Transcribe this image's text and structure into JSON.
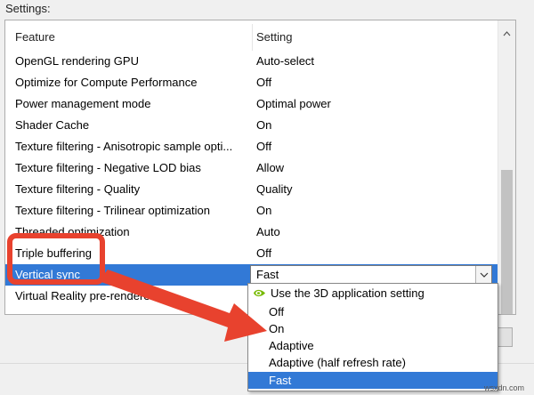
{
  "heading": "Settings:",
  "columns": {
    "feature": "Feature",
    "setting": "Setting"
  },
  "rows": [
    {
      "feature": "OpenGL rendering GPU",
      "setting": "Auto-select"
    },
    {
      "feature": "Optimize for Compute Performance",
      "setting": "Off"
    },
    {
      "feature": "Power management mode",
      "setting": "Optimal power"
    },
    {
      "feature": "Shader Cache",
      "setting": "On"
    },
    {
      "feature": "Texture filtering - Anisotropic sample opti...",
      "setting": "Off"
    },
    {
      "feature": "Texture filtering - Negative LOD bias",
      "setting": "Allow"
    },
    {
      "feature": "Texture filtering - Quality",
      "setting": "Quality"
    },
    {
      "feature": "Texture filtering - Trilinear optimization",
      "setting": "On"
    },
    {
      "feature": "Threaded optimization",
      "setting": "Auto"
    },
    {
      "feature": "Triple buffering",
      "setting": "Off"
    },
    {
      "feature": "Vertical sync",
      "setting": "Fast"
    },
    {
      "feature": "Virtual Reality pre-rendered",
      "setting": ""
    }
  ],
  "selected_row": "Vertical sync",
  "dropdown": {
    "value": "Fast",
    "options": [
      {
        "label": "Use the 3D application setting",
        "icon": "nvidia-icon"
      },
      {
        "label": "Off"
      },
      {
        "label": "On"
      },
      {
        "label": "Adaptive"
      },
      {
        "label": "Adaptive (half refresh rate)"
      },
      {
        "label": "Fast",
        "selected": true
      }
    ]
  },
  "colors": {
    "selection": "#3279d6",
    "annotation": "#e8422e",
    "nvidia_green": "#76b900"
  },
  "watermark": "wsxdn.com"
}
